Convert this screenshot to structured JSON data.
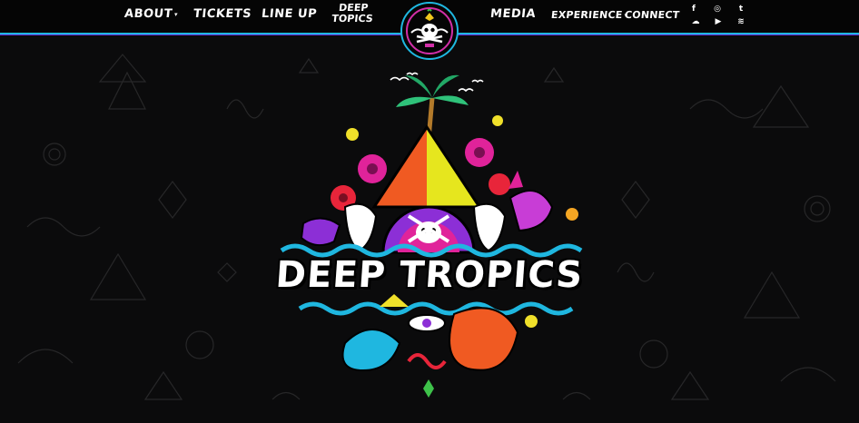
{
  "nav": {
    "about": "ABOUT",
    "tickets": "TICKETS",
    "lineup": "LINE UP",
    "deep_topics_line1": "DEEP",
    "deep_topics_line2": "TOPICS",
    "media": "MEDIA",
    "experience": "EXPERIENCE",
    "connect": "CONNECT",
    "caret": "▾"
  },
  "social": {
    "facebook": "f",
    "instagram": "◎",
    "twitter": "t",
    "soundcloud": "☁",
    "youtube": "▶",
    "spotify": "≋"
  },
  "hero": {
    "title": "DEEP TROPICS"
  },
  "icons": [
    "skull-crossbones-icon",
    "facebook-icon",
    "instagram-icon",
    "twitter-icon",
    "soundcloud-icon",
    "youtube-icon",
    "spotify-icon"
  ],
  "colors": {
    "accent_cyan": "#1fb7e0",
    "accent_magenta": "#d22fa8",
    "accent_purple": "#6a2bd8",
    "background": "#0b0b0c"
  }
}
